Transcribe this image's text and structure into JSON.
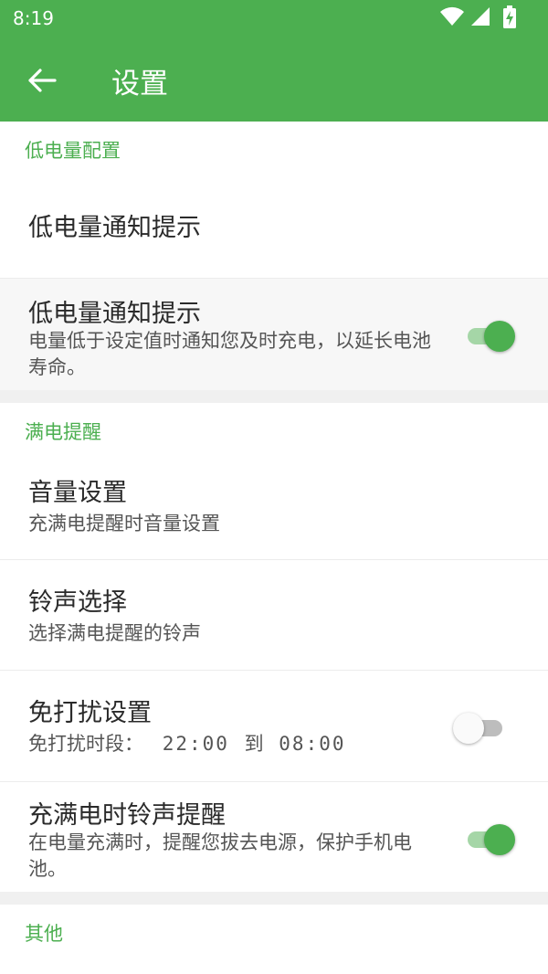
{
  "status_bar": {
    "time": "8:19",
    "icons": [
      "wifi-icon",
      "cellular-signal-icon",
      "battery-charging-icon"
    ]
  },
  "app_bar": {
    "back_icon": "arrow-back-icon",
    "title": "设置"
  },
  "sections": {
    "low_battery": {
      "header": "低电量配置",
      "notify_label": "低电量通知提示",
      "notify_toggle": {
        "title": "低电量通知提示",
        "summary": "电量低于设定值时通知您及时充电，以延长电池寿命。",
        "checked": true
      }
    },
    "full_charge": {
      "header": "满电提醒",
      "volume": {
        "title": "音量设置",
        "summary": "充满电提醒时音量设置"
      },
      "ringtone": {
        "title": "铃声选择",
        "summary": "选择满电提醒的铃声"
      },
      "dnd": {
        "title": "免打扰设置",
        "summary_prefix": "免打扰时段：",
        "start": "22:00",
        "to": "到",
        "end": "08:00",
        "checked": false
      },
      "ring_on_full": {
        "title": "充满电时铃声提醒",
        "summary": "在电量充满时，提醒您拔去电源，保护手机电池。",
        "checked": true
      }
    },
    "other": {
      "header": "其他"
    }
  },
  "colors": {
    "primary": "#4caf50",
    "switch_track_on": "#a5d6a7",
    "switch_track_off": "#bdbdbd",
    "divider": "#f0f0f0"
  }
}
